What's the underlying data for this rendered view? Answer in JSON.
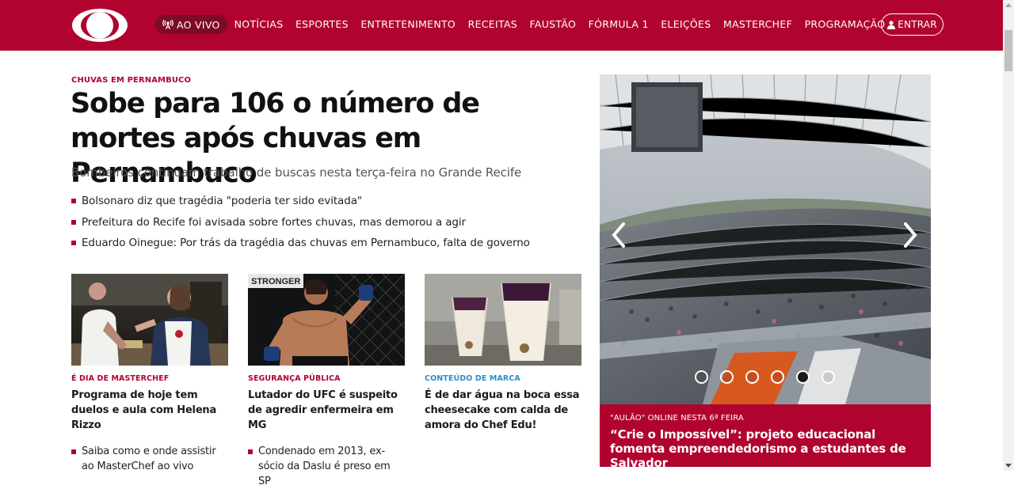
{
  "nav": {
    "live_label": "AO VIVO",
    "items": [
      "NOTÍCIAS",
      "ESPORTES",
      "ENTRETENIMENTO",
      "RECEITAS",
      "FAUSTÃO",
      "FÓRMULA 1",
      "ELEIÇÕES",
      "MASTERCHEF",
      "PROGRAMAÇÃO"
    ],
    "login_label": "ENTRAR",
    "brand_color": "#b0042f"
  },
  "headline": {
    "kicker": "CHUVAS EM PERNAMBUCO",
    "title": "Sobe para 106 o número de mortes após chuvas em Pernambuco",
    "subtitle": "Bombeiros continuam trabalho de buscas nesta terça-feira no Grande Recife",
    "bullets": [
      "Bolsonaro diz que tragédia \"poderia ter sido evitada\"",
      "Prefeitura do Recife foi avisada sobre fortes chuvas, mas demorou a agir",
      "Eduardo Oinegue: Por trás da tragédia das chuvas em Pernambuco, falta de governo"
    ]
  },
  "cards": [
    {
      "tag": "É DIA DE MASTERCHEF",
      "title": "Programa de hoje tem duelos e aula com Helena Rizzo",
      "related": "Saiba como e onde assistir ao MasterChef ao vivo"
    },
    {
      "tag": "SEGURANÇA PÚBLICA",
      "title": "Lutador do UFC é suspeito de agredir enfermeira em MG",
      "related": "Condenado em 2013, ex-sócio da Daslu é preso em SP",
      "banner_text": "STRONGER"
    },
    {
      "tag": "CONTEÚDO DE MARCA",
      "title": "É de dar água na boca essa cheesecake com calda de amora do Chef Edu!",
      "related": ""
    }
  ],
  "slider": {
    "kicker": "\"AULÃO\" ONLINE NESTA 6ª FEIRA",
    "title": "“Crie o Impossível”: projeto educacional fomenta empreendedorismo a estudantes de Salvador",
    "dot_count": 6,
    "active_index": 4
  }
}
